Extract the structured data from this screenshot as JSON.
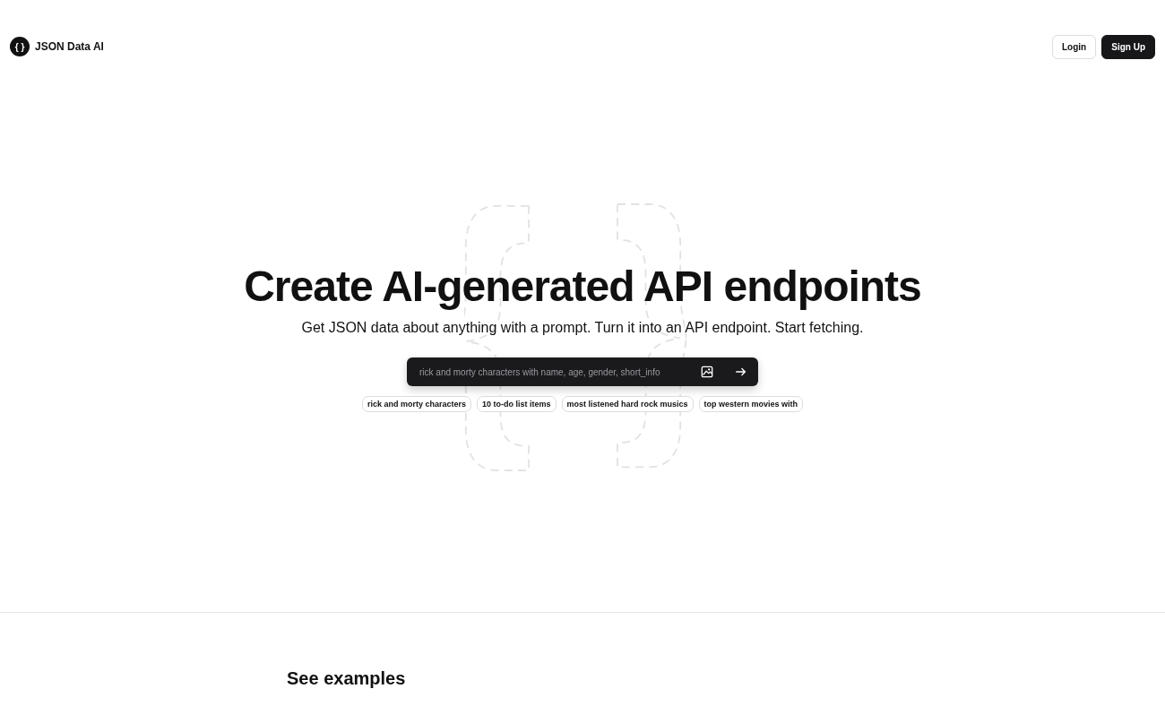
{
  "header": {
    "logo_mark": "{ }",
    "brand": "JSON Data AI",
    "buttons": [
      {
        "label": "Login",
        "kind": "outline"
      },
      {
        "label": "Sign Up",
        "kind": "solid"
      }
    ]
  },
  "hero": {
    "title": "Create AI-generated API endpoints",
    "subtitle": "Get JSON data about anything with a prompt. Turn it into an API endpoint. Start fetching.",
    "prompt": {
      "placeholder": "rick and morty characters with name, age, gender, short_info"
    },
    "suggestions": [
      "rick and morty characters",
      "10 to-do list items",
      "most listened hard rock musics",
      "top western movies with"
    ]
  },
  "examples": {
    "heading": "See examples"
  }
}
